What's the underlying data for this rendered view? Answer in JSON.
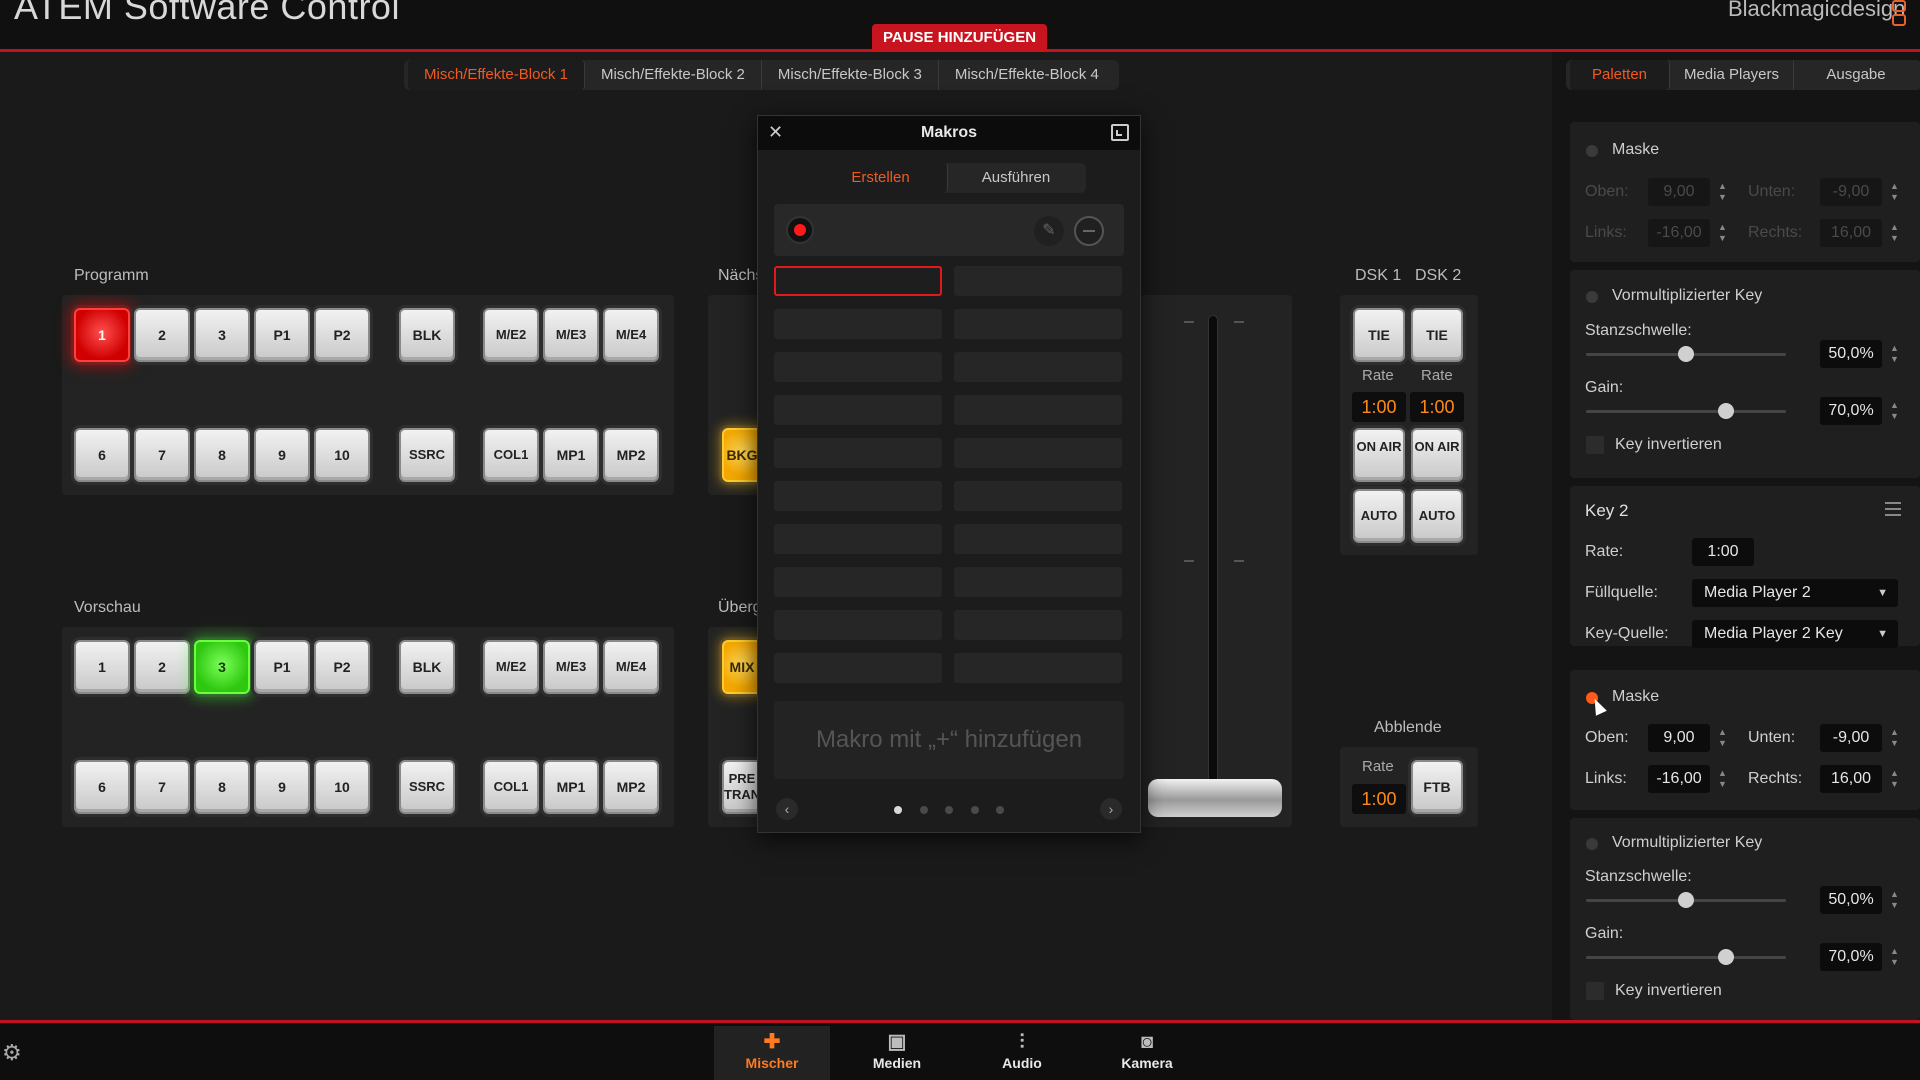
{
  "app": {
    "title": "ATEM Software Control",
    "pause_button": "PAUSE HINZUFÜGEN",
    "brand": "Blackmagicdesign"
  },
  "me_tabs": [
    "Misch/Effekte-Block 1",
    "Misch/Effekte-Block 2",
    "Misch/Effekte-Block 3",
    "Misch/Effekte-Block 4"
  ],
  "program": {
    "label": "Programm",
    "row1": [
      "1",
      "2",
      "3",
      "P1",
      "P2",
      "BLK",
      "M/E2",
      "M/E3",
      "M/E4"
    ],
    "row2": [
      "6",
      "7",
      "8",
      "9",
      "10",
      "SSRC",
      "COL1",
      "MP1",
      "MP2"
    ],
    "active": "1"
  },
  "preview": {
    "label": "Vorschau",
    "row1": [
      "1",
      "2",
      "3",
      "P1",
      "P2",
      "BLK",
      "M/E2",
      "M/E3",
      "M/E4"
    ],
    "row2": [
      "6",
      "7",
      "8",
      "9",
      "10",
      "SSRC",
      "COL1",
      "MP1",
      "MP2"
    ],
    "active": "3"
  },
  "next_transition": {
    "label_partial": "Nächs",
    "bkgd_partial": "BKG"
  },
  "transition_style": {
    "label_partial": "Überg",
    "mix_partial": "MIX",
    "prev_trans_partial": "PRE TRAN"
  },
  "macros": {
    "title": "Makros",
    "close_icon": "close-icon",
    "tabs": [
      "Erstellen",
      "Ausführen"
    ],
    "active_tab": "Erstellen",
    "add_hint": "Makro mit „+“ hinzufügen",
    "pages": 5,
    "current_page": 1
  },
  "dsk": {
    "labels": [
      "DSK 1",
      "DSK 2"
    ],
    "tie": "TIE",
    "rate_label": "Rate",
    "rates": [
      "1:00",
      "1:00"
    ],
    "on_air": "ON AIR",
    "auto": "AUTO"
  },
  "fade_to_black": {
    "label": "Abblende",
    "rate_label": "Rate",
    "rate": "1:00",
    "button": "FTB"
  },
  "right_panel": {
    "tabs": [
      "Paletten",
      "Media Players",
      "Ausgabe"
    ],
    "active_tab": "Paletten",
    "key1_mask": {
      "label": "Maske",
      "enabled": false,
      "top_label": "Oben:",
      "top": "9,00",
      "bottom_label": "Unten:",
      "bottom": "-9,00",
      "left_label": "Links:",
      "left": "-16,00",
      "right_label": "Rechts:",
      "right": "16,00"
    },
    "key1_premult": {
      "label": "Vormultiplizierter Key",
      "clip_label": "Stanzschwelle:",
      "clip": "50,0%",
      "clip_level": 0.5,
      "gain_label": "Gain:",
      "gain": "70,0%",
      "gain_level": 0.7,
      "invert_label": "Key invertieren"
    },
    "key2": {
      "title": "Key 2",
      "rate_label": "Rate:",
      "rate": "1:00",
      "fill_label": "Füllquelle:",
      "fill": "Media Player 2",
      "key_label": "Key-Quelle:",
      "key": "Media Player 2 Key"
    },
    "key2_mask": {
      "label": "Maske",
      "enabled": true,
      "top_label": "Oben:",
      "top": "9,00",
      "bottom_label": "Unten:",
      "bottom": "-9,00",
      "left_label": "Links:",
      "left": "-16,00",
      "right_label": "Rechts:",
      "right": "16,00"
    },
    "key2_premult": {
      "label": "Vormultiplizierter Key",
      "clip_label": "Stanzschwelle:",
      "clip": "50,0%",
      "clip_level": 0.5,
      "gain_label": "Gain:",
      "gain": "70,0%",
      "gain_level": 0.7,
      "invert_label": "Key invertieren"
    }
  },
  "bottom_nav": [
    {
      "label": "Mischer",
      "icon": "mixer-icon",
      "active": true
    },
    {
      "label": "Medien",
      "icon": "media-icon",
      "active": false
    },
    {
      "label": "Audio",
      "icon": "audio-icon",
      "active": false
    },
    {
      "label": "Kamera",
      "icon": "camera-icon",
      "active": false
    }
  ],
  "colors": {
    "accent": "#f05a22",
    "tally_red": "#e00000",
    "tally_green": "#3ad01a",
    "bar_red": "#c1121f"
  }
}
